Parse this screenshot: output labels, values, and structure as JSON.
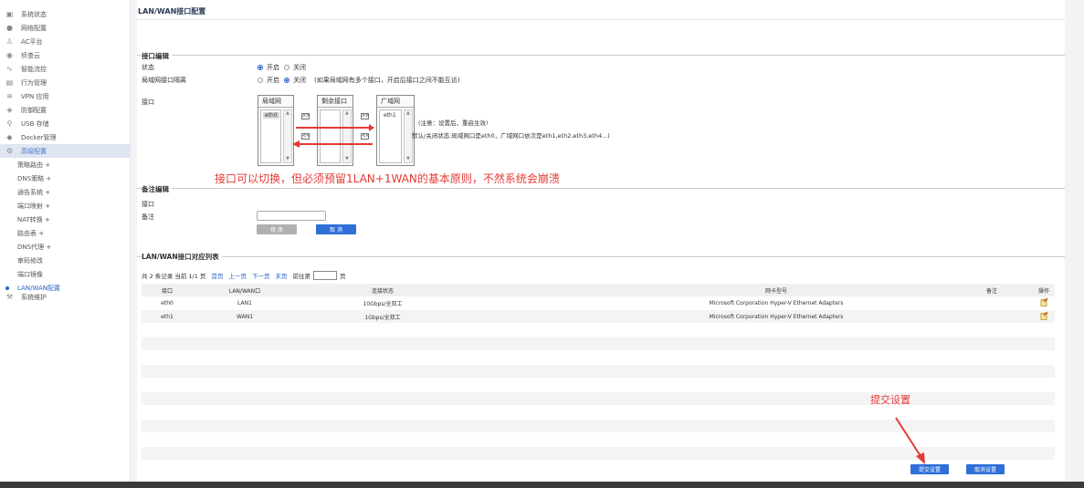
{
  "sidebar": {
    "items": [
      {
        "label": "系统状态",
        "icon": "monitor-icon",
        "glyph": "▣"
      },
      {
        "label": "网络配置",
        "icon": "globe-icon",
        "glyph": "●"
      },
      {
        "label": "AC平台",
        "icon": "network-tree-icon",
        "glyph": "♙"
      },
      {
        "label": "侦查云",
        "icon": "eye-icon",
        "glyph": "◉"
      },
      {
        "label": "智能流控",
        "icon": "trend-icon",
        "glyph": "∿"
      },
      {
        "label": "行为管理",
        "icon": "document-icon",
        "glyph": "▤"
      },
      {
        "label": "VPN 应用",
        "icon": "wifi-icon",
        "glyph": "≋"
      },
      {
        "label": "防御配置",
        "icon": "shield-icon",
        "glyph": "◈"
      },
      {
        "label": "USB 存储",
        "icon": "usb-icon",
        "glyph": "⚲"
      },
      {
        "label": "Docker管理",
        "icon": "docker-icon",
        "glyph": "◆"
      },
      {
        "label": "高级配置",
        "icon": "gear-icon",
        "glyph": "⚙"
      }
    ],
    "subitems": [
      "策略路由 +",
      "DNS策略 +",
      "通告系统 +",
      "端口映射 +",
      "NAT转换 +",
      "路由表 +",
      "DNS代理 +",
      "审码修改",
      "端口镜像",
      "LAN/WAN配置"
    ],
    "last_item": {
      "label": "系统维护",
      "icon": "wrench-icon",
      "glyph": "⚒"
    }
  },
  "page": {
    "title": "LAN/WAN接口配置",
    "sec_interface": "接口编辑",
    "sec_remark": "备注编辑",
    "sec_list": "LAN/WAN接口对应列表"
  },
  "form": {
    "status_label": "状态",
    "status_on": "开启",
    "status_off": "关闭",
    "isolation_label": "局域网接口隔离",
    "isolation_on": "开启",
    "isolation_off": "关闭",
    "isolation_note": "(如果局域网有多个接口，开启后接口之间不能互访)",
    "interface_label": "接口",
    "lan_title": "局域网",
    "spare_title": "剩余接口",
    "wan_title": "广域网",
    "lan_items": [
      "eth0"
    ],
    "wan_items": [
      "eth1"
    ],
    "move_left": "<<",
    "move_right": ">>",
    "note1": "(注意：设置后，重启生效!",
    "note2": "默认/关闭状态:局域网口是eth0，广域网口依次是eth1,eth2,eth3,eth4...)",
    "annotation": "接口可以切换，但必须预留1LAN+1WAN的基本原则，不然系统会崩溃"
  },
  "remark": {
    "interface_label": "接口",
    "remark_label": "备注",
    "remark_value": "",
    "modify_btn": "修 改",
    "cancel_btn": "取 消"
  },
  "list": {
    "pager_prefix": "共 2 条记录 当前 1/1 页",
    "first": "首页",
    "prev": "上一页",
    "next": "下一页",
    "last": "末页",
    "goto": "前往第",
    "page_unit": "页",
    "columns": [
      "接口",
      "LAN/WAN口",
      "连接状态",
      "网卡型号",
      "备注",
      "操作"
    ],
    "rows": [
      {
        "iface": "eth0",
        "type": "LAN1",
        "status": "10Gbps/全双工",
        "nic": "Microsoft Corporation Hyper-V Ethernet Adapters",
        "remark": ""
      },
      {
        "iface": "eth1",
        "type": "WAN1",
        "status": "1Gbps/全双工",
        "nic": "Microsoft Corporation Hyper-V Ethernet Adapters",
        "remark": ""
      }
    ]
  },
  "footer": {
    "submit_annotation": "提交设置",
    "submit_btn": "提交设置",
    "cancel_btn": "取消设置"
  },
  "colors": {
    "accent": "#2f6fd8",
    "annotation": "#e53935"
  }
}
